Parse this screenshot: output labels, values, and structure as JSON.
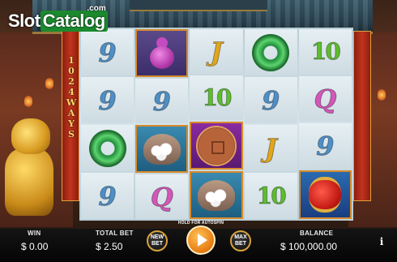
{
  "logo": {
    "slot": "Slot",
    "catalog": "Catalog",
    "com": ".com"
  },
  "ways": {
    "chars": [
      "1",
      "0",
      "2",
      "4",
      "W",
      "A",
      "Y",
      "S"
    ]
  },
  "reels": [
    [
      {
        "symbol": "card-9",
        "label": "9"
      },
      {
        "symbol": "card-9",
        "label": "9"
      },
      {
        "symbol": "jade-disc",
        "label": ""
      },
      {
        "symbol": "card-9",
        "label": "9"
      }
    ],
    [
      {
        "symbol": "purple-gourd",
        "label": ""
      },
      {
        "symbol": "card-9",
        "label": "9"
      },
      {
        "symbol": "pearl-shell",
        "label": ""
      },
      {
        "symbol": "card-q",
        "label": "Q"
      }
    ],
    [
      {
        "symbol": "card-j",
        "label": "J"
      },
      {
        "symbol": "card-10",
        "label": "10"
      },
      {
        "symbol": "bronze-coin",
        "label": ""
      },
      {
        "symbol": "pearl-shell",
        "label": ""
      }
    ],
    [
      {
        "symbol": "jade-disc",
        "label": ""
      },
      {
        "symbol": "card-9",
        "label": "9"
      },
      {
        "symbol": "card-j",
        "label": "J"
      },
      {
        "symbol": "card-10",
        "label": "10"
      }
    ],
    [
      {
        "symbol": "card-10",
        "label": "10"
      },
      {
        "symbol": "card-q",
        "label": "Q"
      },
      {
        "symbol": "card-9",
        "label": "9"
      },
      {
        "symbol": "red-lantern",
        "label": ""
      }
    ]
  ],
  "footer": {
    "win_label": "WIN",
    "win_value": "$ 0.00",
    "total_bet_label": "TOTAL BET",
    "total_bet_value": "$ 2.50",
    "new_bet_label": "NEW BET",
    "autospin_hint": "HOLD FOR AUTOSPIN",
    "max_bet_label": "MAX BET",
    "balance_label": "BALANCE",
    "balance_value": "$ 100,000.00",
    "info_label": "i"
  }
}
